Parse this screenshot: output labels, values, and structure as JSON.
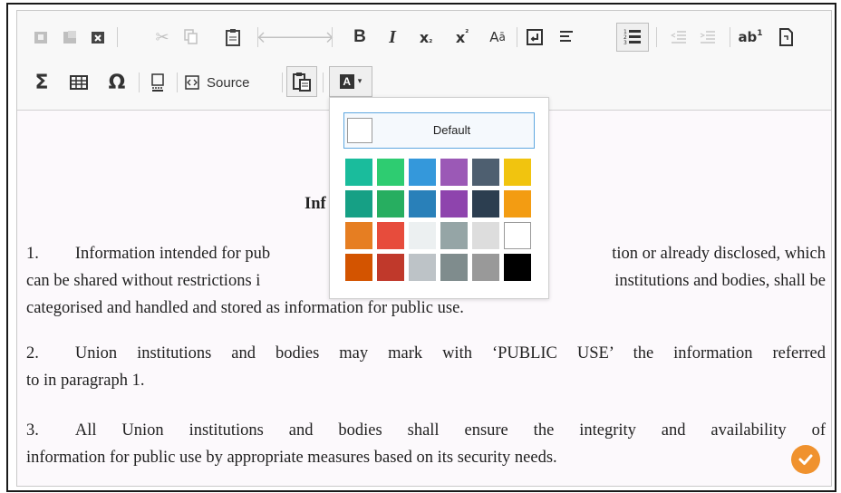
{
  "toolbar": {
    "source_label": "Source",
    "icons": [
      "paste-icon",
      "paste-text-icon",
      "paste-word-icon",
      "cut-icon",
      "copy-icon",
      "paste-clipboard-icon",
      "undo-icon",
      "redo-icon",
      "bold-icon",
      "italic-icon",
      "subscript-icon",
      "superscript-icon",
      "find-replace-icon",
      "line-break-icon",
      "list-style-icon",
      "numbered-list-icon",
      "decrease-indent-icon",
      "increase-indent-icon",
      "footnote-icon",
      "page-icon",
      "sigma-icon",
      "table-icon",
      "omega-icon",
      "page-break-icon",
      "source-icon",
      "paste-special-icon",
      "text-color-icon"
    ],
    "glyphs": {
      "bold": "B",
      "italic": "I",
      "sigma": "Σ",
      "omega": "Ω",
      "text_color_letter": "A"
    }
  },
  "color_panel": {
    "default_label": "Default",
    "swatches": [
      [
        "#1abc9c",
        "#2ecc71",
        "#3498db",
        "#9b59b6",
        "#4e5f70",
        "#f1c40f"
      ],
      [
        "#16a085",
        "#27ae60",
        "#2980b9",
        "#8e44ad",
        "#2c3e50",
        "#f39c12"
      ],
      [
        "#e67e22",
        "#e74c3c",
        "#ecf0f1",
        "#95a5a6",
        "#dddddd",
        "#ffffff"
      ],
      [
        "#d35400",
        "#c0392b",
        "#bdc3c7",
        "#7f8c8d",
        "#999999",
        "#000000"
      ]
    ]
  },
  "document": {
    "title_partial": "Inf",
    "paragraphs": [
      {
        "num": "1.",
        "text_a": "Information intended for pub",
        "text_b": "tion or already disclosed, which",
        "line2_a": "can be shared without restrictions i",
        "line2_b": " institutions and bodies, shall be",
        "line3": "categorised and handled and stored as information for public use."
      },
      {
        "num": "2.",
        "line1": "Union institutions and bodies may mark with ‘PUBLIC USE’ the information referred",
        "line2": "to in paragraph 1."
      },
      {
        "num": "3.",
        "line1": "All Union institutions and bodies shall ensure the integrity and availability of",
        "line2": "information for public use by appropriate measures based on its security needs."
      }
    ]
  },
  "colors": {
    "accent": "#f0922e",
    "panel_border_active": "#5fa8e0"
  }
}
